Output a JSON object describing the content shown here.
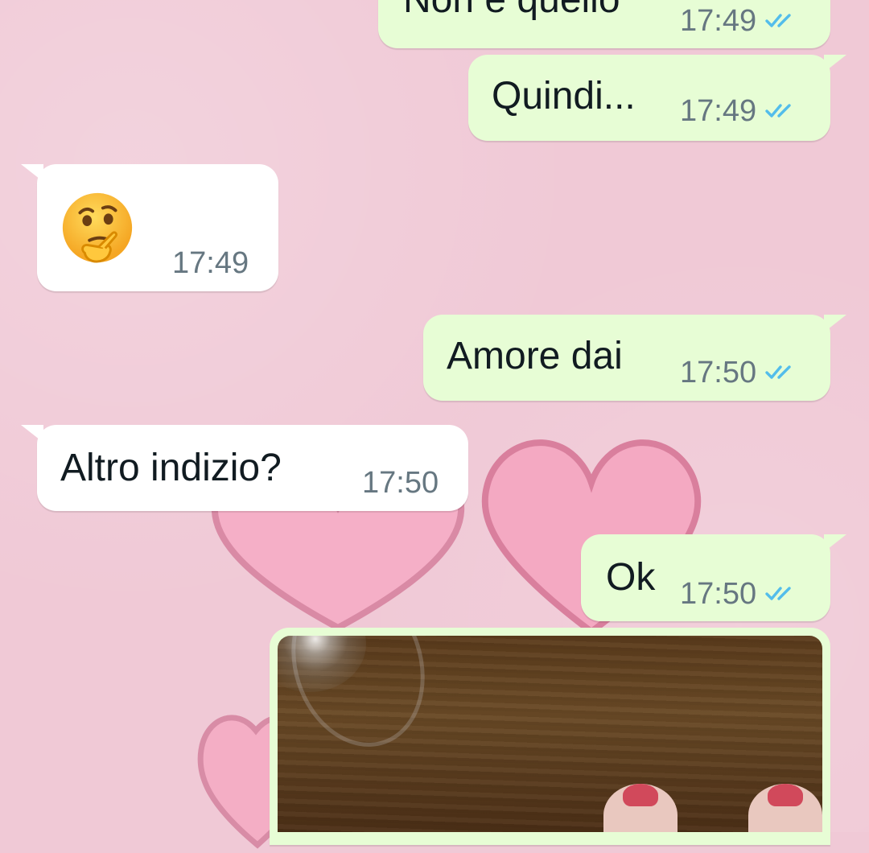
{
  "messages": [
    {
      "id": "m1",
      "direction": "outgoing",
      "text": "Non è quello",
      "time": "17:49",
      "status": "read"
    },
    {
      "id": "m2",
      "direction": "outgoing",
      "text": "Quindi...",
      "time": "17:49",
      "status": "read"
    },
    {
      "id": "m3",
      "direction": "incoming",
      "text": "🤔",
      "time": "17:49"
    },
    {
      "id": "m4",
      "direction": "outgoing",
      "text": "Amore dai",
      "time": "17:50",
      "status": "read"
    },
    {
      "id": "m5",
      "direction": "incoming",
      "text": "Altro indizio?",
      "time": "17:50"
    },
    {
      "id": "m6",
      "direction": "outgoing",
      "text": "Ok",
      "time": "17:50",
      "status": "read"
    },
    {
      "id": "m7",
      "direction": "outgoing",
      "type": "photo"
    }
  ],
  "icons": {
    "read_receipt": "double-check-icon",
    "thinking_emoji": "thinking-face-icon"
  },
  "colors": {
    "wallpaper": "#f0c9d6",
    "outgoing_bubble": "#e7fdd5",
    "incoming_bubble": "#ffffff",
    "read_check": "#53bdeb",
    "meta_text": "#667781",
    "message_text": "#111b21"
  }
}
